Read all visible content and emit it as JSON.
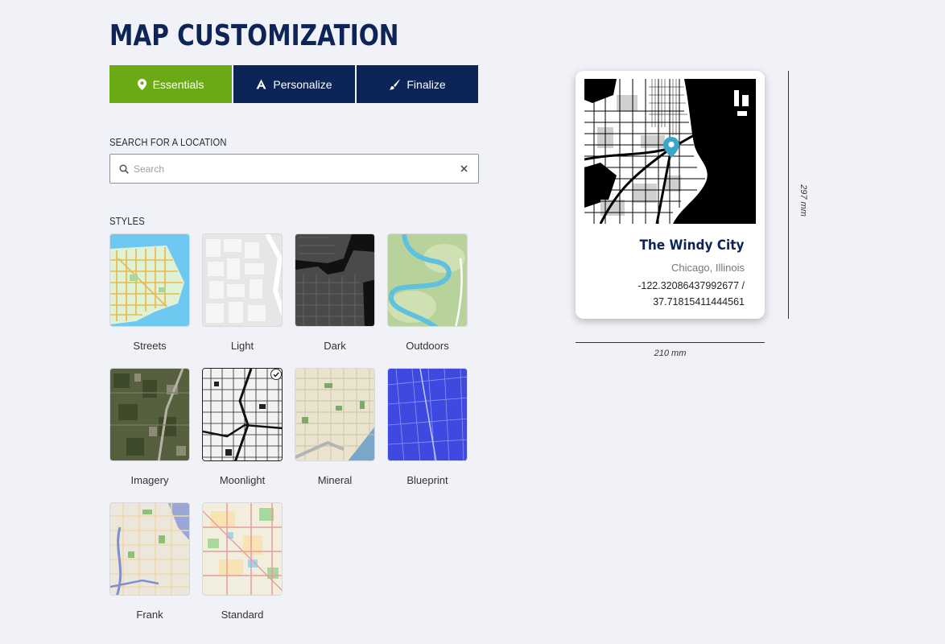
{
  "page": {
    "title": "MAP CUSTOMIZATION"
  },
  "tabs": [
    {
      "label": "Essentials",
      "icon": "map-pin-icon",
      "active": true
    },
    {
      "label": "Personalize",
      "icon": "letter-a-icon",
      "active": false
    },
    {
      "label": "Finalize",
      "icon": "brush-icon",
      "active": false
    }
  ],
  "search": {
    "label": "SEARCH FOR A LOCATION",
    "placeholder": "Search",
    "value": "",
    "clear_icon": "close-icon",
    "search_icon": "search-icon"
  },
  "styles": {
    "label": "STYLES",
    "selected": "Moonlight",
    "items": [
      {
        "name": "Streets"
      },
      {
        "name": "Light"
      },
      {
        "name": "Dark"
      },
      {
        "name": "Outdoors"
      },
      {
        "name": "Imagery"
      },
      {
        "name": "Moonlight"
      },
      {
        "name": "Mineral"
      },
      {
        "name": "Blueprint"
      },
      {
        "name": "Frank"
      },
      {
        "name": "Standard"
      }
    ]
  },
  "preview": {
    "title": "The Windy City",
    "subtitle": "Chicago, Illinois",
    "coords": "-122.32086437992677 / 37.71815411444561",
    "width_label": "210 mm",
    "height_label": "297 mm",
    "pin_icon": "map-pin-icon"
  },
  "colors": {
    "accent": "#6aaa14",
    "navy": "#0d2456",
    "background": "#f1f2f8",
    "pin": "#3aa7c9"
  }
}
